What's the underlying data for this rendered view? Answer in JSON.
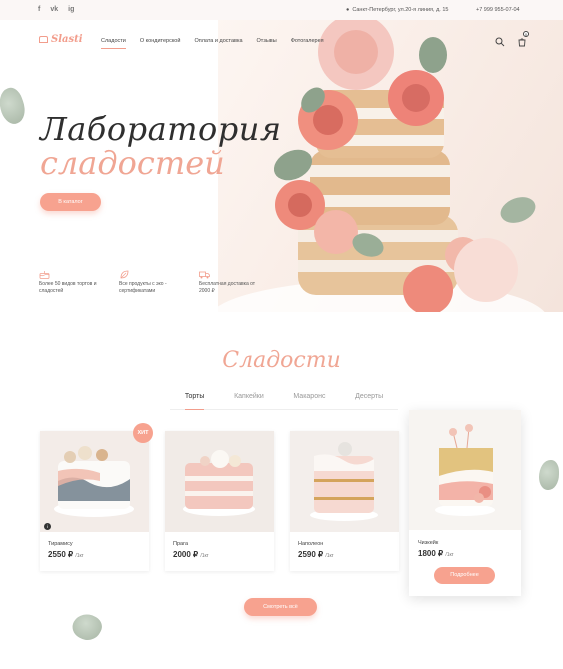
{
  "topbar": {
    "social": [
      "f",
      "vk",
      "ig"
    ],
    "address": "Санкт-Петербург, ул.20-я линия, д. 15",
    "phone": "+7 999 955-07-04"
  },
  "logo": {
    "text": "Slasti"
  },
  "nav": {
    "items": [
      "Сладости",
      "О кондитерской",
      "Оплата и доставка",
      "Отзывы",
      "Фотогалерея"
    ],
    "active": "Сладости",
    "cart_count": "0"
  },
  "hero": {
    "title": "Лаборатория",
    "subtitle": "сладостей",
    "button": "В каталог"
  },
  "features": [
    {
      "icon": "cake-icon",
      "text": "Более 50 видов тортов и сладостей"
    },
    {
      "icon": "leaf-icon",
      "text": "Все продукты с эко - сертификатами"
    },
    {
      "icon": "truck-icon",
      "text": "Бесплатная доставка от 2000 ₽"
    }
  ],
  "catalog": {
    "title": "Сладости",
    "tabs": [
      "Торты",
      "Капкейки",
      "Макаронс",
      "Десерты"
    ],
    "active_tab": "Торты",
    "products": [
      {
        "name": "Тирамису",
        "price": "2550 ₽",
        "unit": "/1кг",
        "badge": "ХИТ",
        "info": "i"
      },
      {
        "name": "Прага",
        "price": "2000 ₽",
        "unit": "/1кг"
      },
      {
        "name": "Наполеон",
        "price": "2590 ₽",
        "unit": "/1кг"
      },
      {
        "name": "Чизкейк",
        "price": "1800 ₽",
        "unit": "/1кг",
        "button": "Подробнее"
      }
    ],
    "see_all": "Смотреть всё"
  },
  "colors": {
    "accent": "#f7a28f",
    "accent_text": "#f0a694"
  }
}
